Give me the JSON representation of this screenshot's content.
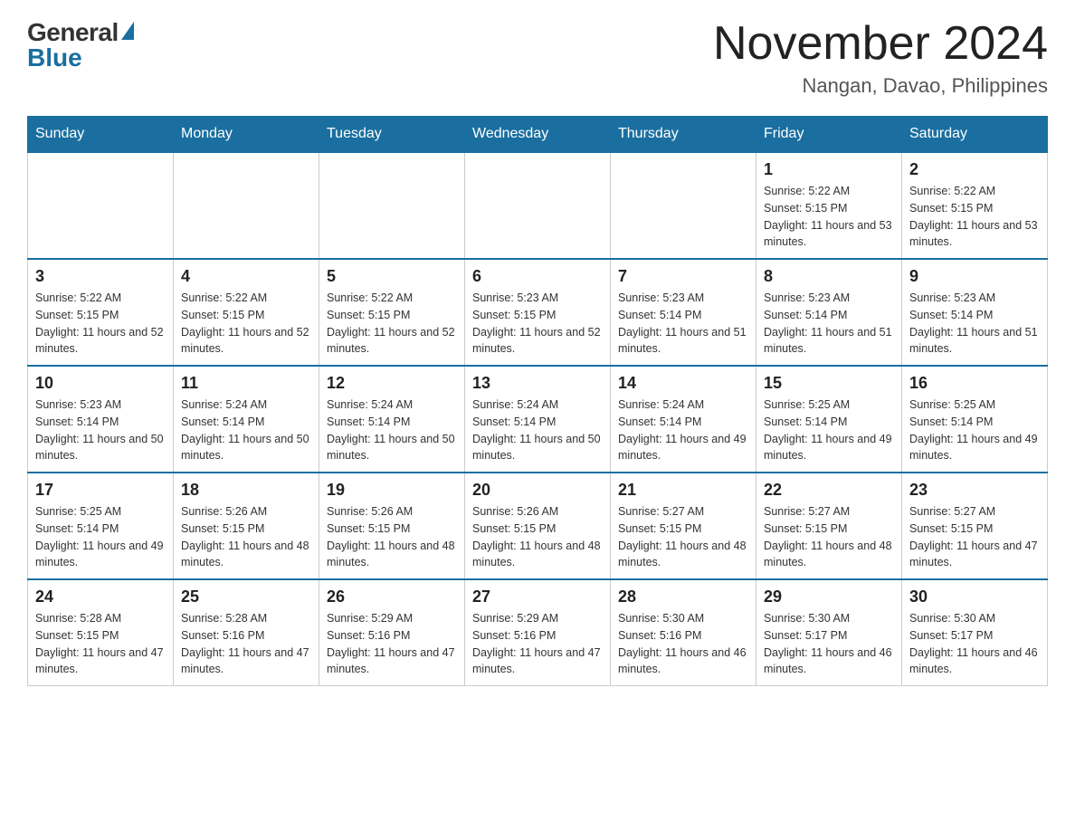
{
  "logo": {
    "general": "General",
    "blue": "Blue"
  },
  "title": "November 2024",
  "location": "Nangan, Davao, Philippines",
  "days_of_week": [
    "Sunday",
    "Monday",
    "Tuesday",
    "Wednesday",
    "Thursday",
    "Friday",
    "Saturday"
  ],
  "weeks": [
    [
      {
        "day": "",
        "empty": true
      },
      {
        "day": "",
        "empty": true
      },
      {
        "day": "",
        "empty": true
      },
      {
        "day": "",
        "empty": true
      },
      {
        "day": "",
        "empty": true
      },
      {
        "day": "1",
        "sunrise": "5:22 AM",
        "sunset": "5:15 PM",
        "daylight": "11 hours and 53 minutes."
      },
      {
        "day": "2",
        "sunrise": "5:22 AM",
        "sunset": "5:15 PM",
        "daylight": "11 hours and 53 minutes."
      }
    ],
    [
      {
        "day": "3",
        "sunrise": "5:22 AM",
        "sunset": "5:15 PM",
        "daylight": "11 hours and 52 minutes."
      },
      {
        "day": "4",
        "sunrise": "5:22 AM",
        "sunset": "5:15 PM",
        "daylight": "11 hours and 52 minutes."
      },
      {
        "day": "5",
        "sunrise": "5:22 AM",
        "sunset": "5:15 PM",
        "daylight": "11 hours and 52 minutes."
      },
      {
        "day": "6",
        "sunrise": "5:23 AM",
        "sunset": "5:15 PM",
        "daylight": "11 hours and 52 minutes."
      },
      {
        "day": "7",
        "sunrise": "5:23 AM",
        "sunset": "5:14 PM",
        "daylight": "11 hours and 51 minutes."
      },
      {
        "day": "8",
        "sunrise": "5:23 AM",
        "sunset": "5:14 PM",
        "daylight": "11 hours and 51 minutes."
      },
      {
        "day": "9",
        "sunrise": "5:23 AM",
        "sunset": "5:14 PM",
        "daylight": "11 hours and 51 minutes."
      }
    ],
    [
      {
        "day": "10",
        "sunrise": "5:23 AM",
        "sunset": "5:14 PM",
        "daylight": "11 hours and 50 minutes."
      },
      {
        "day": "11",
        "sunrise": "5:24 AM",
        "sunset": "5:14 PM",
        "daylight": "11 hours and 50 minutes."
      },
      {
        "day": "12",
        "sunrise": "5:24 AM",
        "sunset": "5:14 PM",
        "daylight": "11 hours and 50 minutes."
      },
      {
        "day": "13",
        "sunrise": "5:24 AM",
        "sunset": "5:14 PM",
        "daylight": "11 hours and 50 minutes."
      },
      {
        "day": "14",
        "sunrise": "5:24 AM",
        "sunset": "5:14 PM",
        "daylight": "11 hours and 49 minutes."
      },
      {
        "day": "15",
        "sunrise": "5:25 AM",
        "sunset": "5:14 PM",
        "daylight": "11 hours and 49 minutes."
      },
      {
        "day": "16",
        "sunrise": "5:25 AM",
        "sunset": "5:14 PM",
        "daylight": "11 hours and 49 minutes."
      }
    ],
    [
      {
        "day": "17",
        "sunrise": "5:25 AM",
        "sunset": "5:14 PM",
        "daylight": "11 hours and 49 minutes."
      },
      {
        "day": "18",
        "sunrise": "5:26 AM",
        "sunset": "5:15 PM",
        "daylight": "11 hours and 48 minutes."
      },
      {
        "day": "19",
        "sunrise": "5:26 AM",
        "sunset": "5:15 PM",
        "daylight": "11 hours and 48 minutes."
      },
      {
        "day": "20",
        "sunrise": "5:26 AM",
        "sunset": "5:15 PM",
        "daylight": "11 hours and 48 minutes."
      },
      {
        "day": "21",
        "sunrise": "5:27 AM",
        "sunset": "5:15 PM",
        "daylight": "11 hours and 48 minutes."
      },
      {
        "day": "22",
        "sunrise": "5:27 AM",
        "sunset": "5:15 PM",
        "daylight": "11 hours and 48 minutes."
      },
      {
        "day": "23",
        "sunrise": "5:27 AM",
        "sunset": "5:15 PM",
        "daylight": "11 hours and 47 minutes."
      }
    ],
    [
      {
        "day": "24",
        "sunrise": "5:28 AM",
        "sunset": "5:15 PM",
        "daylight": "11 hours and 47 minutes."
      },
      {
        "day": "25",
        "sunrise": "5:28 AM",
        "sunset": "5:16 PM",
        "daylight": "11 hours and 47 minutes."
      },
      {
        "day": "26",
        "sunrise": "5:29 AM",
        "sunset": "5:16 PM",
        "daylight": "11 hours and 47 minutes."
      },
      {
        "day": "27",
        "sunrise": "5:29 AM",
        "sunset": "5:16 PM",
        "daylight": "11 hours and 47 minutes."
      },
      {
        "day": "28",
        "sunrise": "5:30 AM",
        "sunset": "5:16 PM",
        "daylight": "11 hours and 46 minutes."
      },
      {
        "day": "29",
        "sunrise": "5:30 AM",
        "sunset": "5:17 PM",
        "daylight": "11 hours and 46 minutes."
      },
      {
        "day": "30",
        "sunrise": "5:30 AM",
        "sunset": "5:17 PM",
        "daylight": "11 hours and 46 minutes."
      }
    ]
  ],
  "labels": {
    "sunrise": "Sunrise:",
    "sunset": "Sunset:",
    "daylight": "Daylight:"
  }
}
